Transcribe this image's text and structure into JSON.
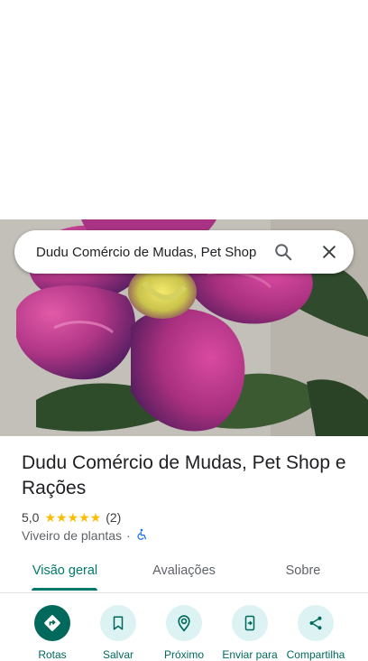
{
  "search": {
    "query": "Dudu Comércio de Mudas, Pet Shop"
  },
  "place": {
    "name": "Dudu Comércio de Mudas, Pet Shop e Rações",
    "rating": "5,0",
    "stars": "★★★★★",
    "review_count": "(2)",
    "category": "Viveiro de plantas",
    "separator": "·"
  },
  "tabs": [
    {
      "label": "Visão geral",
      "active": true
    },
    {
      "label": "Avaliações",
      "active": false
    },
    {
      "label": "Sobre",
      "active": false
    }
  ],
  "actions": [
    {
      "label": "Rotas",
      "icon": "directions-icon"
    },
    {
      "label": "Salvar",
      "icon": "bookmark-icon"
    },
    {
      "label": "Próximo",
      "icon": "nearby-icon"
    },
    {
      "label": "Enviar para",
      "icon": "send-to-phone-icon"
    },
    {
      "label": "Compartilha",
      "icon": "share-icon"
    }
  ],
  "colors": {
    "accent": "#00796b",
    "action_bg": "#dcf2f3",
    "star": "#fbbc04",
    "accessible_icon": "#1a73e8"
  }
}
